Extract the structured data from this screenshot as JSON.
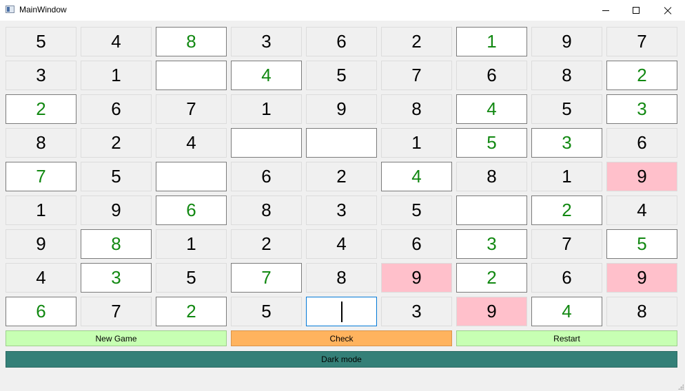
{
  "window": {
    "title": "MainWindow"
  },
  "board": {
    "rows": [
      [
        {
          "v": "5",
          "t": "given"
        },
        {
          "v": "4",
          "t": "given"
        },
        {
          "v": "8",
          "t": "entry"
        },
        {
          "v": "3",
          "t": "given"
        },
        {
          "v": "6",
          "t": "given"
        },
        {
          "v": "2",
          "t": "given"
        },
        {
          "v": "1",
          "t": "entry"
        },
        {
          "v": "9",
          "t": "given"
        },
        {
          "v": "7",
          "t": "given"
        }
      ],
      [
        {
          "v": "3",
          "t": "given"
        },
        {
          "v": "1",
          "t": "given"
        },
        {
          "v": "",
          "t": "entry"
        },
        {
          "v": "4",
          "t": "entry"
        },
        {
          "v": "5",
          "t": "given"
        },
        {
          "v": "7",
          "t": "given"
        },
        {
          "v": "6",
          "t": "given"
        },
        {
          "v": "8",
          "t": "given"
        },
        {
          "v": "2",
          "t": "entry"
        }
      ],
      [
        {
          "v": "2",
          "t": "entry"
        },
        {
          "v": "6",
          "t": "given"
        },
        {
          "v": "7",
          "t": "given"
        },
        {
          "v": "1",
          "t": "given"
        },
        {
          "v": "9",
          "t": "given"
        },
        {
          "v": "8",
          "t": "given"
        },
        {
          "v": "4",
          "t": "entry"
        },
        {
          "v": "5",
          "t": "given"
        },
        {
          "v": "3",
          "t": "entry"
        }
      ],
      [
        {
          "v": "8",
          "t": "given"
        },
        {
          "v": "2",
          "t": "given"
        },
        {
          "v": "4",
          "t": "given"
        },
        {
          "v": "",
          "t": "entry"
        },
        {
          "v": "",
          "t": "entry"
        },
        {
          "v": "1",
          "t": "given"
        },
        {
          "v": "5",
          "t": "entry"
        },
        {
          "v": "3",
          "t": "entry"
        },
        {
          "v": "6",
          "t": "given"
        }
      ],
      [
        {
          "v": "7",
          "t": "entry"
        },
        {
          "v": "5",
          "t": "given"
        },
        {
          "v": "",
          "t": "entry"
        },
        {
          "v": "6",
          "t": "given"
        },
        {
          "v": "2",
          "t": "given"
        },
        {
          "v": "4",
          "t": "entry"
        },
        {
          "v": "8",
          "t": "given"
        },
        {
          "v": "1",
          "t": "given"
        },
        {
          "v": "9",
          "t": "error"
        }
      ],
      [
        {
          "v": "1",
          "t": "given"
        },
        {
          "v": "9",
          "t": "given"
        },
        {
          "v": "6",
          "t": "entry"
        },
        {
          "v": "8",
          "t": "given"
        },
        {
          "v": "3",
          "t": "given"
        },
        {
          "v": "5",
          "t": "given"
        },
        {
          "v": "",
          "t": "entry"
        },
        {
          "v": "2",
          "t": "entry"
        },
        {
          "v": "4",
          "t": "given"
        }
      ],
      [
        {
          "v": "9",
          "t": "given"
        },
        {
          "v": "8",
          "t": "entry"
        },
        {
          "v": "1",
          "t": "given"
        },
        {
          "v": "2",
          "t": "given"
        },
        {
          "v": "4",
          "t": "given"
        },
        {
          "v": "6",
          "t": "given"
        },
        {
          "v": "3",
          "t": "entry"
        },
        {
          "v": "7",
          "t": "given"
        },
        {
          "v": "5",
          "t": "entry"
        }
      ],
      [
        {
          "v": "4",
          "t": "given"
        },
        {
          "v": "3",
          "t": "entry"
        },
        {
          "v": "5",
          "t": "given"
        },
        {
          "v": "7",
          "t": "entry"
        },
        {
          "v": "8",
          "t": "given"
        },
        {
          "v": "9",
          "t": "error"
        },
        {
          "v": "2",
          "t": "entry"
        },
        {
          "v": "6",
          "t": "given"
        },
        {
          "v": "9",
          "t": "error"
        }
      ],
      [
        {
          "v": "6",
          "t": "entry"
        },
        {
          "v": "7",
          "t": "given"
        },
        {
          "v": "2",
          "t": "entry"
        },
        {
          "v": "5",
          "t": "given"
        },
        {
          "v": "",
          "t": "entry",
          "focused": true
        },
        {
          "v": "3",
          "t": "given"
        },
        {
          "v": "9",
          "t": "error"
        },
        {
          "v": "4",
          "t": "entry"
        },
        {
          "v": "8",
          "t": "given"
        }
      ]
    ]
  },
  "buttons": {
    "new_game": "New Game",
    "check": "Check",
    "restart": "Restart",
    "dark_mode": "Dark mode"
  },
  "colors": {
    "entry_text": "#118811",
    "error_bg": "#ffc0cb",
    "new_game_bg": "#c7ffb3",
    "check_bg": "#ffb35e",
    "dark_mode_bg": "#348078"
  }
}
